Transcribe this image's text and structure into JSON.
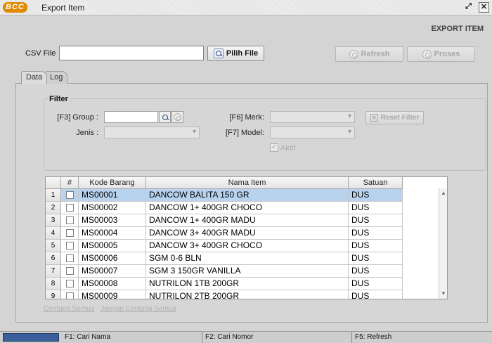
{
  "window": {
    "logo": "BCC",
    "title": "Export Item"
  },
  "page_heading": "EXPORT ITEM",
  "csv": {
    "label": "CSV File",
    "value": "",
    "pick_button": "Pilih File",
    "refresh_button": "Refresh",
    "process_button": "Proses"
  },
  "tabs": [
    "Data",
    "Log"
  ],
  "filter": {
    "title": "Filter",
    "group_label": "[F3] Group :",
    "group_value": "",
    "jenis_label": "Jenis :",
    "merk_label": "[F6] Merk:",
    "model_label": "[F7] Model:",
    "aktif_label": "Aktif",
    "reset_button": "Reset Filter"
  },
  "grid": {
    "columns": [
      "#",
      "Kode Barang",
      "Nama Item",
      "Satuan"
    ],
    "rows": [
      {
        "no": "1",
        "kode": "MS00001",
        "nama": "DANCOW BALITA 150 GR",
        "satuan": "DUS"
      },
      {
        "no": "2",
        "kode": "MS00002",
        "nama": "DANCOW 1+ 400GR CHOCO",
        "satuan": "DUS"
      },
      {
        "no": "3",
        "kode": "MS00003",
        "nama": "DANCOW 1+ 400GR MADU",
        "satuan": "DUS"
      },
      {
        "no": "4",
        "kode": "MS00004",
        "nama": "DANCOW 3+ 400GR MADU",
        "satuan": "DUS"
      },
      {
        "no": "5",
        "kode": "MS00005",
        "nama": "DANCOW 3+ 400GR CHOCO",
        "satuan": "DUS"
      },
      {
        "no": "6",
        "kode": "MS00006",
        "nama": "SGM 0-6 BLN",
        "satuan": "DUS"
      },
      {
        "no": "7",
        "kode": "MS00007",
        "nama": "SGM 3 150GR VANILLA",
        "satuan": "DUS"
      },
      {
        "no": "8",
        "kode": "MS00008",
        "nama": "NUTRILON 1TB 200GR",
        "satuan": "DUS"
      },
      {
        "no": "9",
        "kode": "MS00009",
        "nama": "NUTRILON 2TB 200GR",
        "satuan": "DUS"
      }
    ]
  },
  "links": {
    "check_all": "Centang Semua",
    "uncheck_all": "Jangan Centang Semua"
  },
  "status": {
    "f1": "F1: Cari Nama",
    "f2": "F2: Cari Nomor",
    "f5": "F5: Refresh"
  }
}
